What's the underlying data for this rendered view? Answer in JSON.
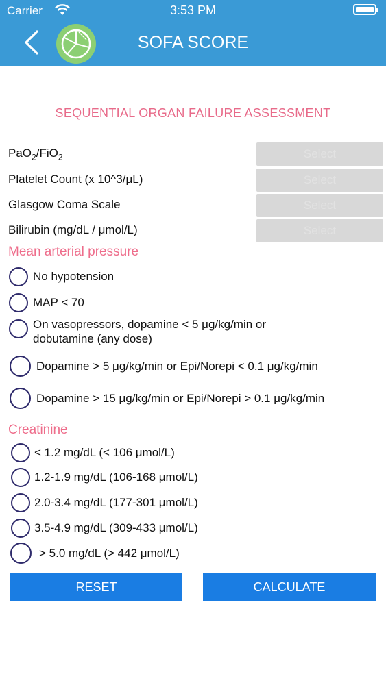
{
  "status": {
    "carrier": "Carrier",
    "time": "3:53 PM"
  },
  "nav": {
    "title": "SOFA SCORE",
    "back_icon": "chevron-left-icon",
    "logo_icon": "pie-chart-icon"
  },
  "heading": "SEQUENTIAL ORGAN FAILURE ASSESSMENT",
  "fields": {
    "pao2": {
      "label_pre": "PaO",
      "label_sub1": "2",
      "label_mid": "/FiO",
      "label_sub2": "2",
      "select": "Select"
    },
    "platelet": {
      "label": "Platelet Count (x 10^3/μL)",
      "select": "Select"
    },
    "gcs": {
      "label": "Glasgow Coma Scale",
      "select": "Select"
    },
    "bilirubin": {
      "label": "Bilirubin (mg/dL / μmol/L)",
      "select": "Select"
    }
  },
  "map": {
    "title": "Mean arterial pressure",
    "options": [
      "No hypotension",
      "MAP < 70",
      "On vasopressors, dopamine < 5 μg/kg/min or dobutamine (any dose)",
      "Dopamine > 5 μg/kg/min or Epi/Norepi < 0.1 μg/kg/min",
      "Dopamine > 15 μg/kg/min or Epi/Norepi > 0.1 μg/kg/min"
    ]
  },
  "creatinine": {
    "title": "Creatinine",
    "options": [
      "< 1.2 mg/dL (< 106 μmol/L)",
      "1.2-1.9 mg/dL (106-168 μmol/L)",
      "2.0-3.4 mg/dL (177-301 μmol/L)",
      "3.5-4.9 mg/dL (309-433 μmol/L)",
      "> 5.0 mg/dL (> 442 μmol/L)"
    ]
  },
  "buttons": {
    "reset": "RESET",
    "calculate": "CALCULATE"
  },
  "colors": {
    "header": "#3a9ad6",
    "accent": "#ee6d8b",
    "button": "#1a7de3",
    "radio": "#2e2a6b",
    "select_bg": "#d8d8d8"
  }
}
